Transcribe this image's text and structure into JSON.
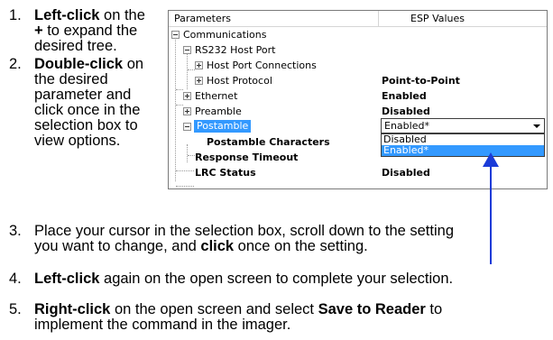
{
  "steps_top": [
    {
      "num": "1.",
      "parts": [
        {
          "b": "Left-click"
        },
        {
          "t": " on the"
        },
        {
          "br": true
        },
        {
          "b": "+"
        },
        {
          "t": " to expand the"
        },
        {
          "br": true
        },
        {
          "t": "desired tree."
        }
      ]
    },
    {
      "num": "2.",
      "parts": [
        {
          "b": "Double-click"
        },
        {
          "t": " on"
        },
        {
          "br": true
        },
        {
          "t": "the desired"
        },
        {
          "br": true
        },
        {
          "t": "parameter and"
        },
        {
          "br": true
        },
        {
          "t": "click once in the"
        },
        {
          "br": true
        },
        {
          "t": "selection box to"
        },
        {
          "br": true
        },
        {
          "t": "view options."
        }
      ]
    }
  ],
  "steps_bottom": [
    {
      "num": "3.",
      "parts": [
        {
          "t": "Place your cursor in the selection box, scroll down to the setting"
        },
        {
          "br": true
        },
        {
          "t": "you want to change, and "
        },
        {
          "b": "click"
        },
        {
          "t": " once on the setting."
        }
      ]
    },
    {
      "num": "4.",
      "parts": [
        {
          "b": "Left-click"
        },
        {
          "t": " again on the open screen to complete your selection."
        }
      ]
    },
    {
      "num": "5.",
      "parts": [
        {
          "b": "Right-click"
        },
        {
          "t": " on the open screen and select "
        },
        {
          "b": "Save to Reader"
        },
        {
          "t": " to"
        },
        {
          "br": true
        },
        {
          "t": "implement the command in the imager."
        }
      ]
    }
  ],
  "panel": {
    "col_parameters": "Parameters",
    "col_values": "ESP Values",
    "rows": [
      {
        "label": "Communications",
        "value": "",
        "bold": false,
        "state": "open"
      },
      {
        "label": "RS232 Host Port",
        "value": "",
        "bold": false,
        "state": "open"
      },
      {
        "label": "Host Port Connections",
        "value": "",
        "bold": false,
        "state": "closed"
      },
      {
        "label": "Host Protocol",
        "value": "Point-to-Point",
        "bold": true,
        "state": "closed"
      },
      {
        "label": "Ethernet",
        "value": "Enabled",
        "bold": true,
        "state": "closed"
      },
      {
        "label": "Preamble",
        "value": "Disabled",
        "bold": true,
        "state": "closed"
      },
      {
        "label": "Postamble",
        "value": "",
        "bold": false,
        "state": "open"
      },
      {
        "label": "Postamble Characters",
        "value": "",
        "bold": true,
        "state": "leaf"
      },
      {
        "label": "Response Timeout",
        "value": "",
        "bold": true,
        "state": "leaf"
      },
      {
        "label": "LRC Status",
        "value": "Disabled",
        "bold": true,
        "state": "leaf"
      }
    ],
    "select_value": "Enabled*",
    "options": [
      "Disabled",
      "Enabled*"
    ],
    "highlighted_option": "Enabled*",
    "arrow_color": "#1a3bd8",
    "highlight_color": "#3399ff"
  }
}
